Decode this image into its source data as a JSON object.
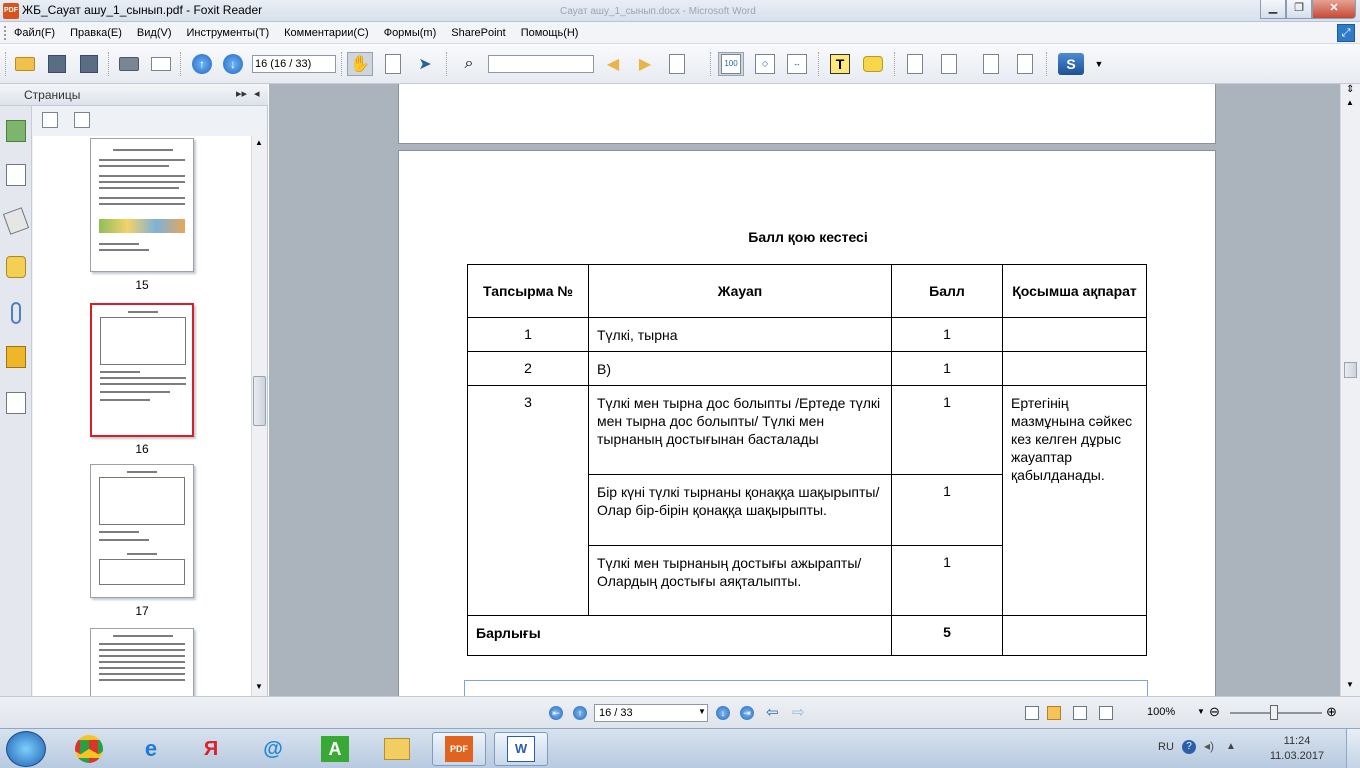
{
  "window": {
    "app_icon": "PDF",
    "title": "ЖБ_Сауат ашу_1_сынып.pdf - Foxit Reader",
    "background_window": "Сауат ашу_1_сынып.docx - Microsoft Word"
  },
  "menu": [
    "Файл(F)",
    "Правка(E)",
    "Вид(V)",
    "Инструменты(T)",
    "Комментарии(C)",
    "Формы(m)",
    "SharePoint",
    "Помощь(H)"
  ],
  "toolbar": {
    "page_field": "16 (16 / 33)",
    "find_placeholder": "",
    "actual_size_label": "100"
  },
  "left_panel": {
    "title": "Страницы",
    "thumbnails": [
      {
        "num": "15"
      },
      {
        "num": "16"
      },
      {
        "num": "17"
      }
    ]
  },
  "document": {
    "heading": "Балл қою кестесі",
    "table": {
      "headers": [
        "Тапсырма №",
        "Жауап",
        "Балл",
        "Қосымша ақпарат"
      ],
      "rows": [
        {
          "task": "1",
          "answer": "Түлкі, тырна",
          "score": "1",
          "info": ""
        },
        {
          "task": "2",
          "answer": "В)",
          "score": "1",
          "info": ""
        },
        {
          "task": "3",
          "answer": "Түлкі мен тырна дос болыпты /Ертеде түлкі мен тырна дос болыпты/ Түлкі мен тырнаның достығынан басталады",
          "score": "1",
          "info": "Ертегінің мазмұнына сәйкес кез келген дұрыс жауаптар қабылданады."
        },
        {
          "answer": "Бір күні түлкі тырнаны қонаққа шақырыпты/ Олар бір-бірін қонаққа шақырыпты.",
          "score": "1"
        },
        {
          "answer": "Түлкі мен тырнаның достығы ажырапты/ Олардың достығы аяқталыпты.",
          "score": "1"
        }
      ],
      "total_label": "Барлығы",
      "total_score": "5"
    }
  },
  "statusbar": {
    "page_nav": "16 / 33",
    "zoom": "100%"
  },
  "taskbar": {
    "lang": "RU",
    "time": "11:24",
    "date": "11.03.2017"
  },
  "colors": {
    "selected_thumb_border": "#d4202a",
    "doc_background": "#abb3bd",
    "accent": "#2466b8"
  }
}
